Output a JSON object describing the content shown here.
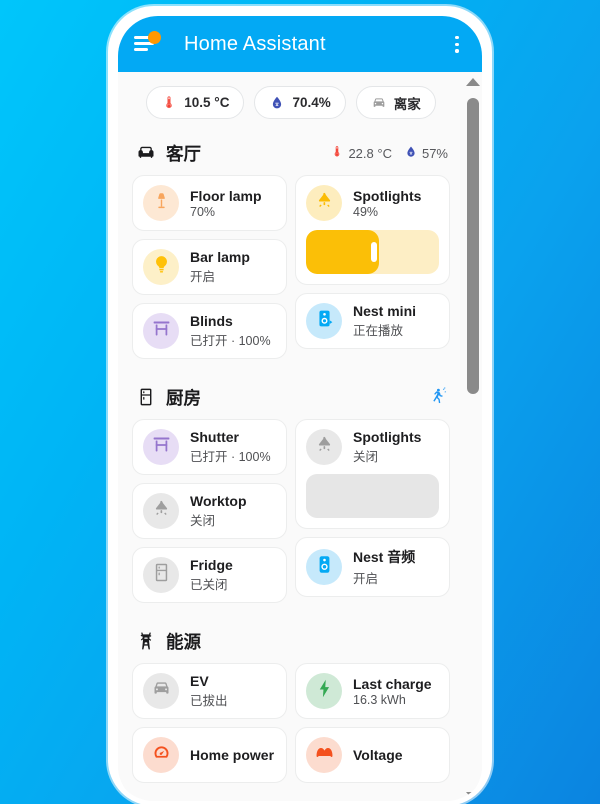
{
  "app": {
    "title": "Home Assistant",
    "menu_icon": "hamburger-menu-icon",
    "menu_badge": "notification-dot",
    "overflow_icon": "more-vertical-icon",
    "accent_color": "#03a9f4",
    "badge_color": "#ff9800"
  },
  "chips": [
    {
      "icon": "thermometer-icon",
      "label": "10.5 °C",
      "color": "#f44336"
    },
    {
      "icon": "water-drop-icon",
      "label": "70.4%",
      "color": "#3f51b5"
    },
    {
      "icon": "car-icon",
      "label": "离家",
      "color": "#9e9e9e"
    }
  ],
  "areas": [
    {
      "id": "living-room",
      "icon": "sofa-icon",
      "title": "客厅",
      "sensors": [
        {
          "icon": "thermometer-icon",
          "label": "22.8 °C",
          "color": "#f44336"
        },
        {
          "icon": "water-drop-icon",
          "label": "57%",
          "color": "#3f51b5"
        }
      ],
      "left": [
        {
          "name": "Floor lamp",
          "state": "70%",
          "icon": "floor-lamp-icon",
          "icon_color": "#f8a55c",
          "bg_color": "#fde8d4"
        },
        {
          "name": "Bar lamp",
          "state": "开启",
          "icon": "bulb-icon",
          "icon_color": "#ffc107",
          "bg_color": "#fdf0c8"
        },
        {
          "name": "Blinds",
          "state": "已打开 · 100%",
          "icon": "blinds-icon",
          "icon_color": "#9575cd",
          "bg_color": "#e7ddf5"
        }
      ],
      "right": [
        {
          "type": "light",
          "name": "Spotlights",
          "state": "49%",
          "icon": "spotlight-icon",
          "icon_color": "#fbbc04",
          "bg_color": "#fdedbe",
          "slider_percent": 55,
          "fill_color": "#fbbf07",
          "track_color": "#fdeec5"
        },
        {
          "name": "Nest mini",
          "state": "正在播放",
          "icon": "speaker-cast-icon",
          "icon_color": "#03a9f4",
          "bg_color": "#c6e9fb"
        }
      ]
    },
    {
      "id": "kitchen",
      "icon": "fridge-icon",
      "title": "厨房",
      "status_icon": "motion-walking-icon",
      "status_color": "#2196f3",
      "sensors": [],
      "left": [
        {
          "name": "Shutter",
          "state": "已打开 · 100%",
          "icon": "blinds-icon",
          "icon_color": "#9575cd",
          "bg_color": "#e7ddf5"
        },
        {
          "name": "Worktop",
          "state": "关闭",
          "icon": "spotlight-icon",
          "icon_color": "#9e9e9e",
          "bg_color": "#e8e8e8"
        },
        {
          "name": "Fridge",
          "state": "已关闭",
          "icon": "fridge-icon",
          "icon_color": "#9e9e9e",
          "bg_color": "#e8e8e8"
        }
      ],
      "right": [
        {
          "type": "light",
          "name": "Spotlights",
          "state": "关闭",
          "icon": "spotlight-icon",
          "icon_color": "#9e9e9e",
          "bg_color": "#e8e8e8",
          "slider_percent": 0,
          "fill_color": "#e6e6e6",
          "track_color": "#e6e6e6"
        },
        {
          "name": "Nest 音频",
          "state": "开启",
          "icon": "speaker-icon",
          "icon_color": "#03a9f4",
          "bg_color": "#c6e9fb"
        }
      ]
    },
    {
      "id": "energy",
      "icon": "transmission-tower-icon",
      "title": "能源",
      "sensors": [],
      "left": [
        {
          "name": "EV",
          "state": "已拔出",
          "icon": "car-icon",
          "icon_color": "#9e9e9e",
          "bg_color": "#e8e8e8"
        },
        {
          "name": "Home power",
          "state": "",
          "icon": "gauge-icon",
          "icon_color": "#f4511e",
          "bg_color": "#fcdccf"
        }
      ],
      "right": [
        {
          "name": "Last charge",
          "state": "16.3 kWh",
          "icon": "lightning-icon",
          "icon_color": "#34a853",
          "bg_color": "#cfe9d6"
        },
        {
          "name": "Voltage",
          "state": "",
          "icon": "sine-wave-icon",
          "icon_color": "#f4511e",
          "bg_color": "#fcdccf"
        }
      ]
    }
  ],
  "scrollbar": {
    "up_icon": "scroll-up-arrow",
    "down_icon": "scroll-down-arrow",
    "thumb": "scroll-thumb"
  }
}
